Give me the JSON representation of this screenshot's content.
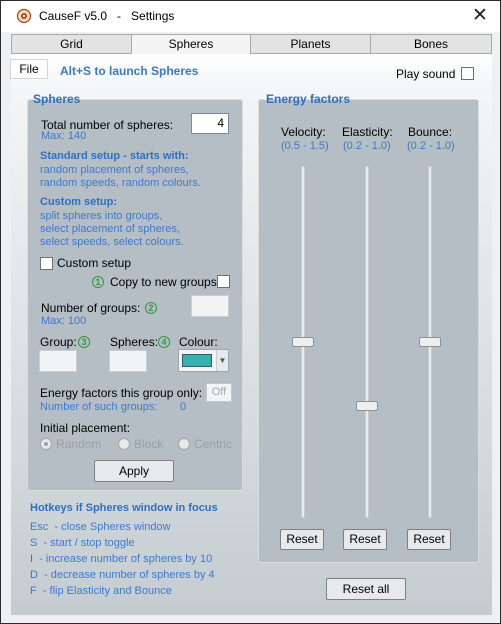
{
  "window": {
    "title": "CauseF v5.0   -   Settings",
    "close_glyph": "✕"
  },
  "tabs": [
    {
      "label": "Grid",
      "active": false
    },
    {
      "label": "Spheres",
      "active": true
    },
    {
      "label": "Planets",
      "active": false
    },
    {
      "label": "Bones",
      "active": false
    }
  ],
  "menu": {
    "file_label": "File",
    "hint": "Alt+S to launch Spheres",
    "play_sound_label": "Play sound",
    "play_sound_checked": false
  },
  "spheres": {
    "group_title": "Spheres",
    "total_label": "Total number of spheres:",
    "total_value": "4",
    "total_max": "Max:  140",
    "standard_title": "Standard setup - starts with:",
    "standard_lines": [
      "random placement of spheres,",
      "random speeds, random colours."
    ],
    "custom_title": "Custom setup:",
    "custom_lines": [
      "split spheres into groups,",
      "select placement of spheres,",
      "select speeds, select colours."
    ],
    "custom_setup_label": "Custom setup",
    "custom_setup_checked": false,
    "copy_label": "Copy to new groups:",
    "copy_marker": "1",
    "copy_checked": false,
    "num_groups_label": "Number of groups:",
    "num_groups_marker": "2",
    "num_groups_value": "",
    "num_groups_max": "Max:  100",
    "group_label": "Group:",
    "group_marker": "3",
    "group_value": "",
    "spheres_label": "Spheres:",
    "spheres_marker": "4",
    "spheres_value": "",
    "colour_label": "Colour:",
    "colour_value": "#37b0ae",
    "energy_only_label": "Energy factors this group only:",
    "energy_only_button": "Off",
    "such_groups_label": "Number of such groups:",
    "such_groups_value": "0",
    "placement_label": "Initial placement:",
    "placement_options": [
      {
        "label": "Random",
        "checked": true
      },
      {
        "label": "Block",
        "checked": false
      },
      {
        "label": "Centric",
        "checked": false
      }
    ],
    "apply_label": "Apply"
  },
  "energy": {
    "group_title": "Energy factors",
    "sliders": [
      {
        "label": "Velocity:",
        "range": "(0.5 - 1.5)",
        "min": 0.5,
        "max": 1.5,
        "value": 1.0,
        "reset_label": "Reset"
      },
      {
        "label": "Elasticity:",
        "range": "(0.2 - 1.0)",
        "min": 0.2,
        "max": 1.0,
        "value": 0.45,
        "reset_label": "Reset"
      },
      {
        "label": "Bounce:",
        "range": "(0.2 - 1.0)",
        "min": 0.2,
        "max": 1.0,
        "value": 0.6,
        "reset_label": "Reset"
      }
    ],
    "reset_all_label": "Reset all"
  },
  "hotkeys": {
    "title": "Hotkeys if Spheres window in focus",
    "items": [
      "Esc  - close Spheres window",
      "S  - start / stop toggle",
      "I  - increase number of spheres by 10",
      "D  - decrease number of spheres by 4",
      "F  - flip Elasticity and Bounce"
    ]
  }
}
